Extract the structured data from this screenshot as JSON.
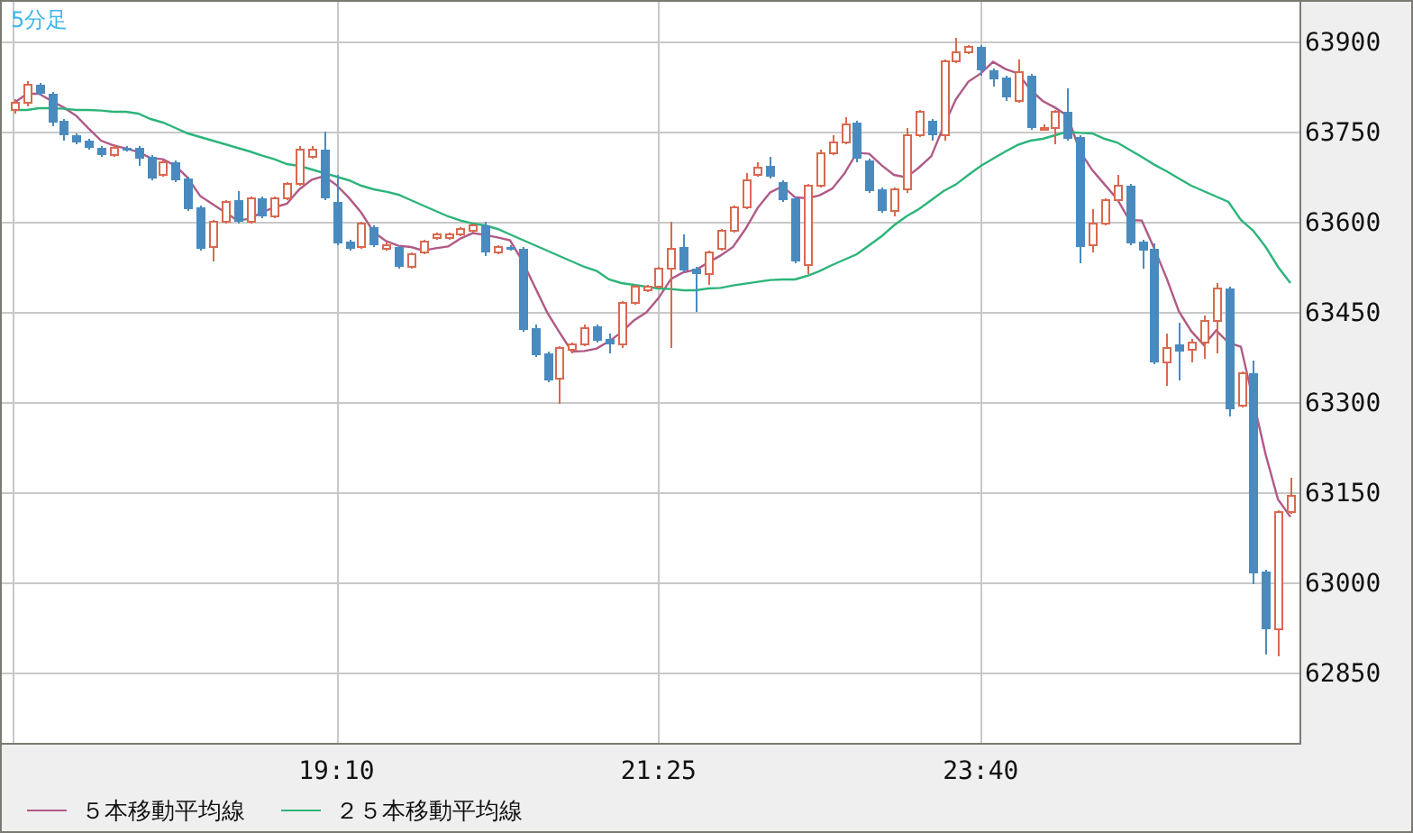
{
  "chart_data": {
    "type": "candlestick",
    "title": "5分足",
    "grid": true,
    "legend": "bottom-left",
    "ylim": [
      62733,
      63966
    ],
    "yticks": [
      62850,
      63000,
      63150,
      63300,
      63450,
      63600,
      63750,
      63900
    ],
    "categories": [
      null,
      null,
      null,
      null,
      null,
      null,
      null,
      null,
      null,
      null,
      null,
      null,
      null,
      null,
      null,
      null,
      null,
      null,
      null,
      null,
      null,
      null,
      null,
      null,
      null,
      null,
      "19:10",
      null,
      null,
      null,
      null,
      null,
      null,
      null,
      null,
      null,
      null,
      null,
      null,
      null,
      null,
      null,
      null,
      null,
      null,
      null,
      null,
      null,
      null,
      null,
      null,
      null,
      "21:25",
      null,
      null,
      null,
      null,
      null,
      null,
      null,
      null,
      null,
      null,
      null,
      null,
      null,
      null,
      null,
      null,
      null,
      null,
      null,
      null,
      null,
      null,
      null,
      null,
      null,
      "23:40",
      null,
      null,
      null,
      null,
      null,
      null,
      null,
      null,
      null,
      null,
      null,
      null,
      null,
      null,
      null,
      null,
      null,
      null,
      null,
      null,
      null,
      null,
      null,
      null,
      null
    ],
    "ohlc": [
      [
        63786,
        63804,
        63780,
        63798
      ],
      [
        63798,
        63834,
        63792,
        63828
      ],
      [
        63828,
        63831,
        63810,
        63813
      ],
      [
        63813,
        63816,
        63759,
        63765
      ],
      [
        63768,
        63771,
        63735,
        63744
      ],
      [
        63744,
        63747,
        63729,
        63732
      ],
      [
        63735,
        63738,
        63720,
        63723
      ],
      [
        63723,
        63726,
        63708,
        63711
      ],
      [
        63711,
        63729,
        63708,
        63723
      ],
      [
        63723,
        63726,
        63717,
        63720
      ],
      [
        63723,
        63726,
        63693,
        63705
      ],
      [
        63708,
        63711,
        63669,
        63672
      ],
      [
        63678,
        63702,
        63675,
        63699
      ],
      [
        63699,
        63702,
        63666,
        63669
      ],
      [
        63672,
        63675,
        63618,
        63621
      ],
      [
        63624,
        63627,
        63552,
        63555
      ],
      [
        63558,
        63603,
        63534,
        63600
      ],
      [
        63600,
        63636,
        63597,
        63633
      ],
      [
        63636,
        63651,
        63597,
        63600
      ],
      [
        63600,
        63642,
        63597,
        63639
      ],
      [
        63639,
        63642,
        63606,
        63609
      ],
      [
        63609,
        63642,
        63606,
        63639
      ],
      [
        63639,
        63666,
        63636,
        63663
      ],
      [
        63663,
        63726,
        63660,
        63720
      ],
      [
        63708,
        63726,
        63705,
        63720
      ],
      [
        63720,
        63750,
        63636,
        63639
      ],
      [
        63633,
        63678,
        63561,
        63564
      ],
      [
        63567,
        63570,
        63552,
        63555
      ],
      [
        63558,
        63600,
        63555,
        63597
      ],
      [
        63591,
        63594,
        63558,
        63561
      ],
      [
        63555,
        63567,
        63552,
        63561
      ],
      [
        63558,
        63561,
        63522,
        63525
      ],
      [
        63525,
        63549,
        63522,
        63546
      ],
      [
        63549,
        63570,
        63546,
        63567
      ],
      [
        63573,
        63582,
        63570,
        63579
      ],
      [
        63573,
        63582,
        63570,
        63579
      ],
      [
        63579,
        63591,
        63576,
        63588
      ],
      [
        63585,
        63597,
        63582,
        63594
      ],
      [
        63594,
        63600,
        63543,
        63549
      ],
      [
        63549,
        63561,
        63546,
        63558
      ],
      [
        63558,
        63561,
        63552,
        63555
      ],
      [
        63555,
        63558,
        63417,
        63420
      ],
      [
        63423,
        63429,
        63375,
        63378
      ],
      [
        63381,
        63384,
        63333,
        63336
      ],
      [
        63339,
        63393,
        63297,
        63390
      ],
      [
        63387,
        63399,
        63381,
        63396
      ],
      [
        63396,
        63429,
        63393,
        63423
      ],
      [
        63426,
        63429,
        63399,
        63402
      ],
      [
        63405,
        63414,
        63381,
        63396
      ],
      [
        63396,
        63468,
        63390,
        63465
      ],
      [
        63465,
        63495,
        63462,
        63492
      ],
      [
        63486,
        63495,
        63483,
        63492
      ],
      [
        63492,
        63525,
        63489,
        63522
      ],
      [
        63522,
        63600,
        63390,
        63555
      ],
      [
        63558,
        63579,
        63516,
        63519
      ],
      [
        63522,
        63525,
        63450,
        63513
      ],
      [
        63513,
        63552,
        63495,
        63549
      ],
      [
        63555,
        63588,
        63552,
        63585
      ],
      [
        63585,
        63627,
        63582,
        63624
      ],
      [
        63624,
        63681,
        63621,
        63669
      ],
      [
        63678,
        63699,
        63675,
        63690
      ],
      [
        63693,
        63708,
        63672,
        63675
      ],
      [
        63666,
        63669,
        63633,
        63636
      ],
      [
        63639,
        63642,
        63531,
        63534
      ],
      [
        63528,
        63663,
        63513,
        63660
      ],
      [
        63660,
        63720,
        63657,
        63714
      ],
      [
        63714,
        63744,
        63711,
        63732
      ],
      [
        63732,
        63774,
        63729,
        63762
      ],
      [
        63765,
        63768,
        63699,
        63705
      ],
      [
        63702,
        63705,
        63648,
        63651
      ],
      [
        63654,
        63657,
        63615,
        63618
      ],
      [
        63618,
        63657,
        63609,
        63654
      ],
      [
        63654,
        63756,
        63648,
        63744
      ],
      [
        63744,
        63786,
        63741,
        63783
      ],
      [
        63768,
        63771,
        63735,
        63744
      ],
      [
        63744,
        63870,
        63735,
        63867
      ],
      [
        63867,
        63906,
        63864,
        63882
      ],
      [
        63882,
        63894,
        63879,
        63891
      ],
      [
        63891,
        63894,
        63843,
        63852
      ],
      [
        63852,
        63855,
        63825,
        63837
      ],
      [
        63840,
        63843,
        63801,
        63807
      ],
      [
        63801,
        63870,
        63798,
        63849
      ],
      [
        63843,
        63846,
        63753,
        63756
      ],
      [
        63756,
        63762,
        63753,
        63756
      ],
      [
        63756,
        63786,
        63729,
        63783
      ],
      [
        63783,
        63822,
        63735,
        63738
      ],
      [
        63741,
        63744,
        63531,
        63558
      ],
      [
        63561,
        63621,
        63549,
        63597
      ],
      [
        63597,
        63639,
        63594,
        63636
      ],
      [
        63636,
        63678,
        63633,
        63660
      ],
      [
        63660,
        63663,
        63561,
        63564
      ],
      [
        63567,
        63570,
        63522,
        63552
      ],
      [
        63555,
        63564,
        63363,
        63366
      ],
      [
        63366,
        63414,
        63327,
        63390
      ],
      [
        63396,
        63432,
        63336,
        63384
      ],
      [
        63387,
        63405,
        63366,
        63399
      ],
      [
        63399,
        63444,
        63372,
        63435
      ],
      [
        63435,
        63498,
        63381,
        63489
      ],
      [
        63489,
        63492,
        63276,
        63288
      ],
      [
        63294,
        63351,
        63291,
        63348
      ],
      [
        63348,
        63369,
        62997,
        63015
      ],
      [
        63018,
        63021,
        62880,
        62922
      ],
      [
        62922,
        63120,
        62877,
        63117
      ],
      [
        63117,
        63174,
        63114,
        63144
      ]
    ],
    "series": [
      {
        "name": "５本移動平均線",
        "type": "line",
        "color": "#b05a86",
        "values": [
          63798,
          63813,
          63813,
          63801,
          63790,
          63776,
          63755,
          63735,
          63727,
          63722,
          63716,
          63706,
          63704,
          63693,
          63673,
          63643,
          63629,
          63616,
          63602,
          63605,
          63616,
          63624,
          63630,
          63654,
          63670,
          63676,
          63661,
          63640,
          63615,
          63583,
          63568,
          63560,
          63558,
          63552,
          63556,
          63559,
          63572,
          63581,
          63578,
          63574,
          63569,
          63535,
          63492,
          63449,
          63416,
          63384,
          63385,
          63389,
          63401,
          63416,
          63436,
          63449,
          63473,
          63505,
          63516,
          63520,
          63532,
          63544,
          63558,
          63588,
          63623,
          63649,
          63659,
          63641,
          63639,
          63644,
          63655,
          63680,
          63715,
          63713,
          63694,
          63678,
          63674,
          63690,
          63709,
          63758,
          63804,
          63833,
          63847,
          63866,
          63854,
          63847,
          63820,
          63801,
          63790,
          63776,
          63718,
          63686,
          63662,
          63638,
          63603,
          63602,
          63556,
          63506,
          63451,
          63418,
          63395,
          63419,
          63399,
          63392,
          null,
          63212,
          63138,
          63109
        ]
      },
      {
        "name": "２５本移動平均線",
        "type": "line",
        "color": "#2cb47a",
        "values": [
          63786,
          63786,
          63789,
          63789,
          63788,
          63786,
          63786,
          63785,
          63783,
          63783,
          63780,
          63771,
          63765,
          63756,
          63747,
          63741,
          63735,
          63729,
          63723,
          63717,
          63710,
          63704,
          63696,
          63693,
          63687,
          63681,
          63675,
          63669,
          63660,
          63654,
          63650,
          63645,
          63636,
          63627,
          63618,
          63609,
          63602,
          63597,
          63594,
          63588,
          63579,
          63570,
          63561,
          63552,
          63543,
          63534,
          63525,
          63518,
          63504,
          63498,
          63495,
          63492,
          63489,
          63488,
          63486,
          63486,
          63489,
          63490,
          63494,
          63497,
          63500,
          63503,
          63504,
          63504,
          63510,
          63518,
          63528,
          63537,
          63546,
          63561,
          63576,
          63594,
          63609,
          63621,
          63636,
          63651,
          63662,
          63678,
          63693,
          63705,
          63717,
          63728,
          63735,
          63738,
          63744,
          63750,
          63748,
          63747,
          63738,
          63732,
          63720,
          63708,
          63695,
          63684,
          63672,
          63660,
          63651,
          63642,
          63633,
          63603,
          63585,
          63558,
          63525,
          63498
        ]
      }
    ]
  }
}
